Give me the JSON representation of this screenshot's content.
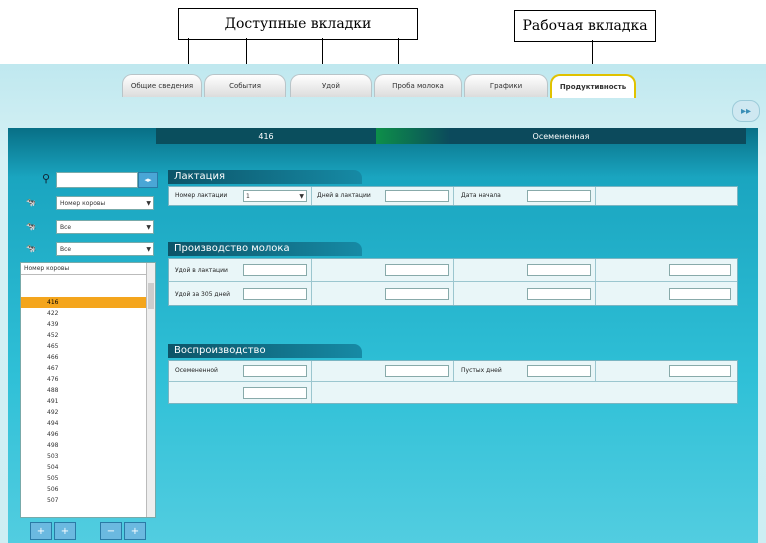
{
  "annotations": {
    "available_tabs": "Доступные вкладки",
    "working_tab": "Рабочая вкладка"
  },
  "tabs": [
    {
      "label": "Общие сведения"
    },
    {
      "label": "События"
    },
    {
      "label": "Удой"
    },
    {
      "label": "Проба молока"
    },
    {
      "label": "Графики"
    },
    {
      "label": "Продуктивность"
    }
  ],
  "nav_button": "▸▸",
  "header": {
    "animal_number": "416",
    "status": "Осемененная"
  },
  "sidebar": {
    "search_value": "",
    "search_arrows": "◂▸",
    "filters": [
      {
        "value": "Номер коровы"
      },
      {
        "value": "Все"
      },
      {
        "value": "Все"
      }
    ],
    "tree_header": "Номер коровы",
    "tree_nodes": [
      {
        "label": ""
      },
      {
        "label": ""
      },
      {
        "label": "416",
        "selected": true
      },
      {
        "label": "422"
      },
      {
        "label": "439"
      },
      {
        "label": "452"
      },
      {
        "label": "465"
      },
      {
        "label": "466"
      },
      {
        "label": "467"
      },
      {
        "label": "476"
      },
      {
        "label": "488"
      },
      {
        "label": "491"
      },
      {
        "label": "492"
      },
      {
        "label": "494"
      },
      {
        "label": "496"
      },
      {
        "label": "498"
      },
      {
        "label": "503"
      },
      {
        "label": "504"
      },
      {
        "label": "505"
      },
      {
        "label": "506"
      },
      {
        "label": "507"
      }
    ],
    "bottom_buttons": [
      "+",
      "+",
      "−",
      "+"
    ]
  },
  "lactation": {
    "title": "Лактация",
    "number_label": "Номер лактации",
    "number_value": "1",
    "days_label": "Дней в лактации",
    "days_value": "",
    "start_label": "Дата начала",
    "start_value": ""
  },
  "milk": {
    "title": "Производство молока",
    "rows": [
      [
        {
          "label": "Удой в лактации",
          "value": ""
        },
        {
          "label": "",
          "value": ""
        },
        {
          "label": "",
          "value": ""
        },
        {
          "label": "",
          "value": ""
        }
      ],
      [
        {
          "label": "Удой за 305 дней",
          "value": ""
        },
        {
          "label": "",
          "value": ""
        },
        {
          "label": "",
          "value": ""
        },
        {
          "label": "",
          "value": ""
        }
      ]
    ]
  },
  "reproduction": {
    "title": "Воспроизводство",
    "fields": [
      {
        "label": "Осемененной",
        "value": ""
      },
      {
        "label": "",
        "value": ""
      },
      {
        "label": "Пустых дней",
        "value": ""
      },
      {
        "label": "",
        "value": ""
      }
    ],
    "calving_label": "",
    "calving_value": ""
  }
}
